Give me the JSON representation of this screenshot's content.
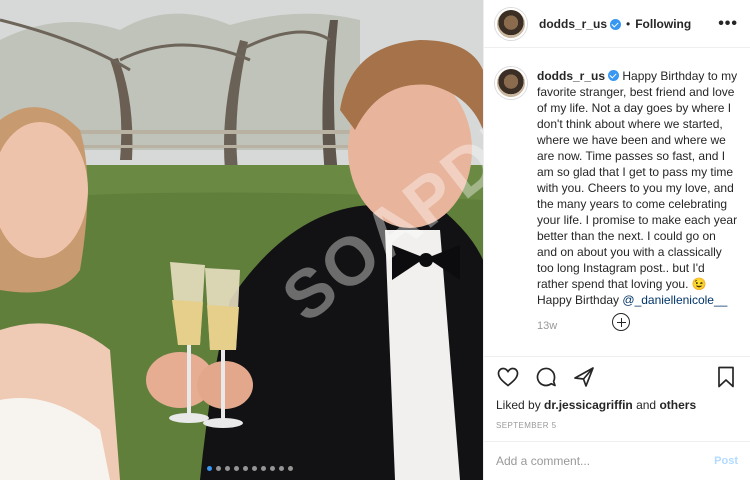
{
  "post": {
    "image_alt": "Couple toasting with champagne glasses",
    "watermark": "SOAPDIRT",
    "carousel_dots": 10,
    "carousel_active": 0
  },
  "header": {
    "username": "dodds_r_us",
    "separator": "•",
    "follow_label": "Following",
    "more_icon": "more-horizontal-icon"
  },
  "caption": {
    "username": "dodds_r_us",
    "text": " Happy Birthday to my favorite stranger, best friend and love of my life. Not a day goes by where I don't think about where we started, where we have been and where we are now. Time passes so fast, and I am so glad that I get to pass my time with you. Cheers to you my love, and the many years to come celebrating your life. I promise to make each year better than the next. I could go on and on about you with a classically too long Instagram post.. but I'd rather spend that loving you. 😉 Happy Birthday ",
    "mention": "@_daniellenicole__",
    "time_ago": "13w"
  },
  "actions": {
    "like": "heart-icon",
    "comment": "comment-icon",
    "share": "share-icon",
    "save": "bookmark-icon"
  },
  "likes": {
    "prefix": "Liked by ",
    "user": "dr.jessicagriffin",
    "and": " and ",
    "others": "others"
  },
  "date": "SEPTEMBER 5",
  "comment_box": {
    "placeholder": "Add a comment...",
    "post_label": "Post"
  },
  "colors": {
    "accent": "#3897f0",
    "mention": "#003569",
    "muted": "#999999",
    "post_disabled": "#b3dbff"
  }
}
